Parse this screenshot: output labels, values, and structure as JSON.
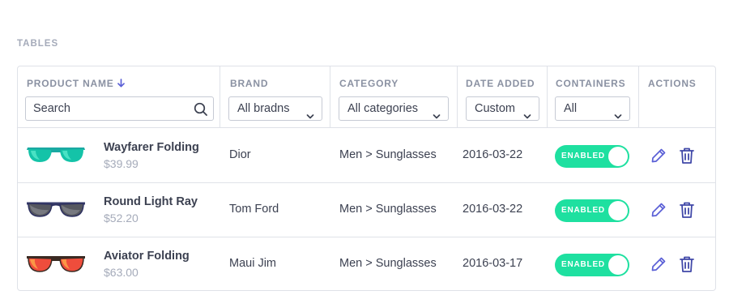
{
  "section_title": "TABLES",
  "columns": {
    "product_name": "PRODUCT NAME",
    "brand": "BRAND",
    "category": "CATEGORY",
    "date_added": "DATE ADDED",
    "containers": "CONTAINERS",
    "actions": "ACTIONS"
  },
  "sort_icon": "arrow-down-icon",
  "filters": {
    "search_placeholder": "Search",
    "brand": "All bradns",
    "category": "All categories",
    "date": "Custom",
    "containers": "All"
  },
  "accent_color": "#1ee0a0",
  "icon_color": "#5a5fd6",
  "rows": [
    {
      "name": "Wayfarer Folding",
      "price": "$39.99",
      "brand": "Dior",
      "category": "Men > Sunglasses",
      "date": "2016-03-22",
      "status": "ENABLED",
      "image": "teal-sunglasses-icon"
    },
    {
      "name": "Round Light Ray",
      "price": "$52.20",
      "brand": "Tom Ford",
      "category": "Men > Sunglasses",
      "date": "2016-03-22",
      "status": "ENABLED",
      "image": "gray-sunglasses-icon"
    },
    {
      "name": "Aviator Folding",
      "price": "$63.00",
      "brand": "Maui Jim",
      "category": "Men > Sunglasses",
      "date": "2016-03-17",
      "status": "ENABLED",
      "image": "red-sunglasses-icon"
    }
  ]
}
